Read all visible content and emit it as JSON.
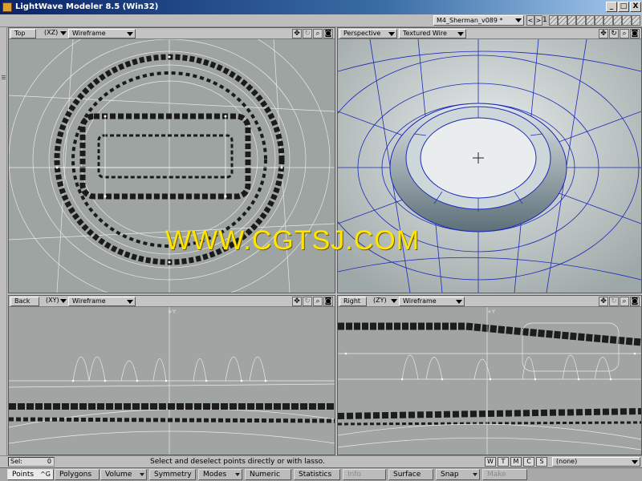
{
  "window": {
    "title": "LightWave Modeler 8.5 (Win32)",
    "buttons": [
      "_",
      "□",
      "X"
    ]
  },
  "toolbar": {
    "object_name": "M4_Sherman_v089 *",
    "nav_prev": "<",
    "nav_next": ">",
    "layer_label": "1"
  },
  "viewports": {
    "top_left": {
      "view": "Top",
      "axes": "(XZ)",
      "mode": "Wireframe"
    },
    "top_right": {
      "view": "Perspective",
      "mode": "Textured Wire"
    },
    "bottom_left": {
      "view": "Back",
      "axes": "(XY)",
      "mode": "Wireframe",
      "axis_label": "+Y"
    },
    "bottom_right": {
      "view": "Right",
      "axes": "(ZY)",
      "mode": "Wireframe",
      "axis_label": "+Y"
    }
  },
  "watermark": "WWW.CGTSJ.COM",
  "status": {
    "sel_label": "Sel:",
    "sel_count": "0",
    "message": "Select and deselect points directly or with lasso.",
    "view_toggles": [
      "W",
      "T",
      "M",
      "C",
      "S"
    ],
    "surface": "(none)"
  },
  "bottom_bar": {
    "points": "Points",
    "points_key": "^G",
    "polygons": "Polygons",
    "volume": "Volume",
    "symmetry": "Symmetry",
    "modes": "Modes",
    "numeric": "Numeric",
    "statistics": "Statistics",
    "info": "Info",
    "surface": "Surface",
    "snap": "Snap",
    "make": "Make"
  },
  "colors": {
    "title_bar": "#0a246a",
    "viewport_bg": "#9aa0a0",
    "wire_blue": "#1a2ab8",
    "watermark": "#ffe600"
  }
}
